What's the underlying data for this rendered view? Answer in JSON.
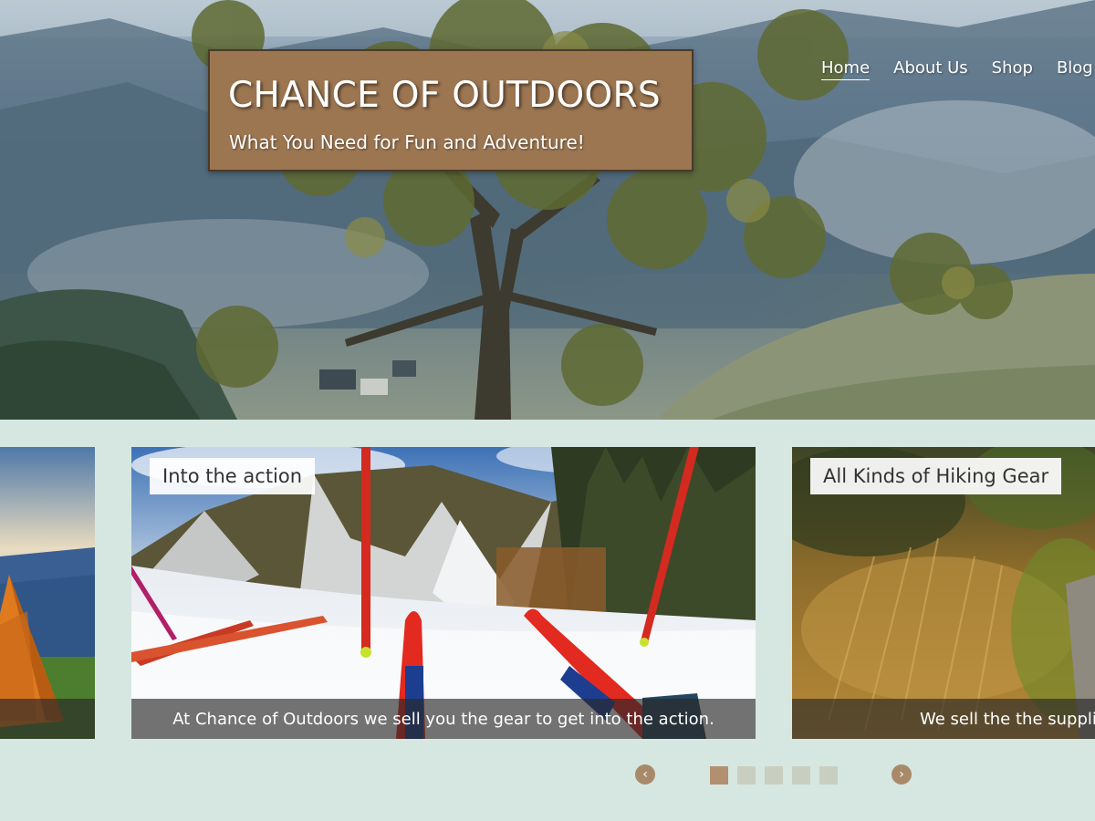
{
  "site": {
    "title": "CHANCE OF OUTDOORS",
    "tagline": "What You Need for Fun and Adventure!"
  },
  "nav": {
    "items": [
      {
        "label": "Home",
        "active": true
      },
      {
        "label": "About Us",
        "active": false
      },
      {
        "label": "Shop",
        "active": false
      },
      {
        "label": "Blog",
        "active": false
      }
    ]
  },
  "carousel": {
    "slides": [
      {
        "position": "previous",
        "title": "",
        "caption": ""
      },
      {
        "position": "current",
        "title": "Into the action",
        "caption": "At Chance of Outdoors we sell you the gear to get into the action."
      },
      {
        "position": "next",
        "title": "All Kinds of Hiking Gear",
        "caption": "We sell the the supplies"
      }
    ],
    "prev_icon": "chevron-left-icon",
    "next_icon": "chevron-right-icon",
    "prev_glyph": "‹",
    "next_glyph": "›",
    "dot_count": 5,
    "active_dot": 1
  },
  "colors": {
    "page_background": "#d6e7e1",
    "brand_box": "#9c7651",
    "accent": "#b2906f",
    "inactive_dot": "#c9cfc0"
  }
}
